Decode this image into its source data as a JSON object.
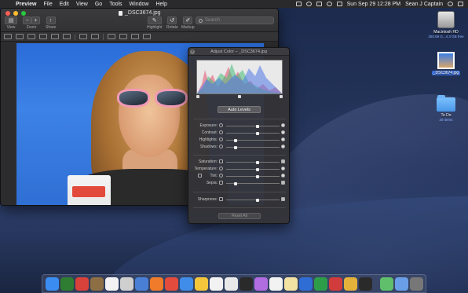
{
  "menubar": {
    "app_name": "Preview",
    "items": [
      "File",
      "Edit",
      "View",
      "Go",
      "Tools",
      "Window",
      "Help"
    ],
    "clock": "Sun Sep 29  12:28 PM",
    "user": "Sean J Captain"
  },
  "preview": {
    "filename": "_DSC3674.jpg",
    "toolbar": {
      "view_label": "View",
      "zoom_label": "Zoom",
      "share_label": "Share",
      "highlight_label": "Highlight",
      "rotate_label": "Rotate",
      "markup_label": "Markup"
    },
    "search_placeholder": "Search"
  },
  "adjust_color": {
    "title": "Adjust Color – _DSC3674.jpg",
    "auto_levels_label": "Auto Levels",
    "rows": [
      {
        "label": "Exposure:",
        "value": 0.6
      },
      {
        "label": "Contrast:",
        "value": 0.6
      },
      {
        "label": "Highlights:",
        "value": 0.15
      },
      {
        "label": "Shadows:",
        "value": 0.15
      },
      {
        "label": "Saturation:",
        "value": 0.6
      },
      {
        "label": "Temperature:",
        "value": 0.6
      },
      {
        "label": "Tint:",
        "value": 0.6
      },
      {
        "label": "Sepia:",
        "value": 0.15
      },
      {
        "label": "Sharpness:",
        "value": 0.6
      }
    ],
    "reset_all_label": "Reset All"
  },
  "desktop_icons": [
    {
      "label": "Macintosh HD",
      "sub": "250.69 G...4.3 GB free"
    },
    {
      "label": "_DSC3674.jpg",
      "sub": ""
    },
    {
      "label": "To Do",
      "sub": "29 items"
    }
  ],
  "dock": {
    "colors": [
      "#3b8cf0",
      "#2e7d32",
      "#d9413b",
      "#8e6e45",
      "#f2f2f2",
      "#cfcfcf",
      "#4a7fd6",
      "#f07b2a",
      "#e34c3c",
      "#3f8de8",
      "#f3c63b",
      "#f2f2f2",
      "#e9e9e9",
      "#2a2a2a",
      "#b06de0",
      "#f2f2f2",
      "#f3e3a3",
      "#2f6cd3",
      "#2e9d4a",
      "#d23b3b",
      "#e4b23a",
      "#2a2a2a",
      "#5fbf6a",
      "#6a9fe8",
      "#777777"
    ]
  }
}
